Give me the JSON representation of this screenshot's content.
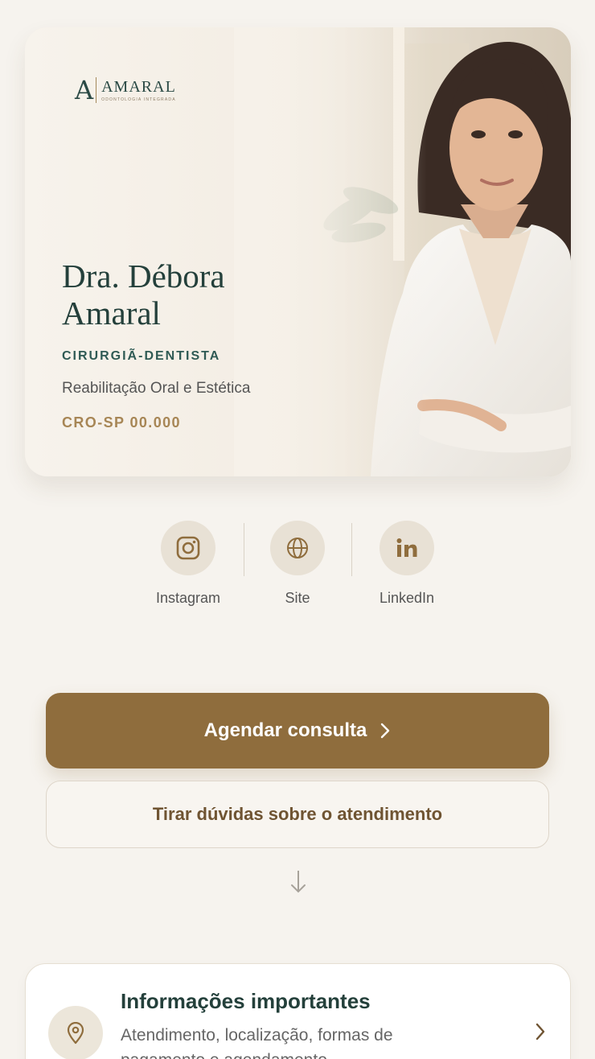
{
  "brand": {
    "logo_letter": "A",
    "name": "AMARAL",
    "tagline": "ODONTOLOGIA INTEGRADA"
  },
  "profile": {
    "name": "Dra. Débora Amaral",
    "title": "CIRURGIÃ-DENTISTA",
    "specialty": "Reabilitação Oral e Estética",
    "registration": "CRO-SP 00.000"
  },
  "socials": [
    {
      "label": "Instagram",
      "icon": "instagram-icon"
    },
    {
      "label": "Site",
      "icon": "globe-icon"
    },
    {
      "label": "LinkedIn",
      "icon": "linkedin-icon"
    }
  ],
  "actions": {
    "primary_label": "Agendar consulta",
    "secondary_label": "Tirar dúvidas sobre o atendimento"
  },
  "info_card": {
    "title": "Informações importantes",
    "description": "Atendimento, localização, formas de pagamento e agendamento",
    "icon": "map-pin-icon"
  },
  "colors": {
    "background": "#f6f3ee",
    "primary": "#8f6d3d",
    "dark_green": "#24403b",
    "gold": "#a78655"
  }
}
